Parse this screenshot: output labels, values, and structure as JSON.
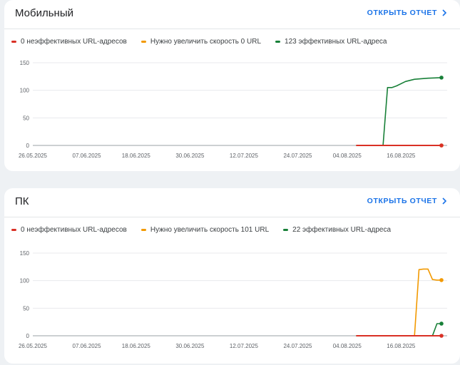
{
  "colors": {
    "poor": "#d93025",
    "needs_improvement": "#f29900",
    "good": "#188038",
    "link": "#1a73e8"
  },
  "open_report_label": "ОТКРЫТЬ ОТЧЕТ",
  "icons": {
    "open_report": "chevron-right-icon"
  },
  "cards": [
    {
      "title": "Мобильный",
      "legend": {
        "poor": "0 неэффективных URL-адресов",
        "needs_improvement": "Нужно увеличить скорость 0 URL",
        "good": "123 эффективных URL-адреса"
      }
    },
    {
      "title": "ПК",
      "legend": {
        "poor": "0 неэффективных URL-адресов",
        "needs_improvement": "Нужно увеличить скорость 101 URL",
        "good": "22 эффективных URL-адреса"
      }
    }
  ],
  "chart_data": [
    {
      "type": "line",
      "title": "",
      "xlabel": "",
      "ylabel": "",
      "ylim": [
        0,
        150
      ],
      "yticks": [
        0,
        50,
        100,
        150
      ],
      "grid": true,
      "legend": "top",
      "x_ticks": [
        "26.05.2025",
        "07.06.2025",
        "18.06.2025",
        "30.06.2025",
        "12.07.2025",
        "24.07.2025",
        "04.08.2025",
        "16.08.2025"
      ],
      "x": [
        "2025-08-06",
        "2025-08-10",
        "2025-08-11",
        "2025-08-12",
        "2025-08-13",
        "2025-08-14",
        "2025-08-15",
        "2025-08-17",
        "2025-08-19",
        "2025-08-22",
        "2025-08-25"
      ],
      "series": [
        {
          "key": "poor",
          "values": [
            0,
            0,
            0,
            0,
            0,
            0,
            0,
            0,
            0,
            0,
            0
          ]
        },
        {
          "key": "needs_improvement",
          "values": [
            0,
            0,
            0,
            0,
            0,
            0,
            0,
            0,
            0,
            0,
            0
          ]
        },
        {
          "key": "good",
          "values": [
            0,
            0,
            0,
            0,
            105,
            105,
            108,
            116,
            120,
            122,
            123
          ]
        }
      ]
    },
    {
      "type": "line",
      "title": "",
      "xlabel": "",
      "ylabel": "",
      "ylim": [
        0,
        150
      ],
      "yticks": [
        0,
        50,
        100,
        150
      ],
      "grid": true,
      "legend": "top",
      "x_ticks": [
        "26.05.2025",
        "07.06.2025",
        "18.06.2025",
        "30.06.2025",
        "12.07.2025",
        "24.07.2025",
        "04.08.2025",
        "16.08.2025"
      ],
      "x": [
        "2025-08-06",
        "2025-08-15",
        "2025-08-19",
        "2025-08-20",
        "2025-08-21",
        "2025-08-22",
        "2025-08-23",
        "2025-08-24",
        "2025-08-25"
      ],
      "series": [
        {
          "key": "poor",
          "values": [
            0,
            0,
            0,
            0,
            0,
            0,
            0,
            0,
            0
          ]
        },
        {
          "key": "needs_improvement",
          "values": [
            0,
            0,
            0,
            120,
            121,
            121,
            102,
            101,
            101
          ]
        },
        {
          "key": "good",
          "values": [
            0,
            0,
            0,
            0,
            0,
            0,
            0,
            22,
            22
          ]
        }
      ]
    }
  ]
}
